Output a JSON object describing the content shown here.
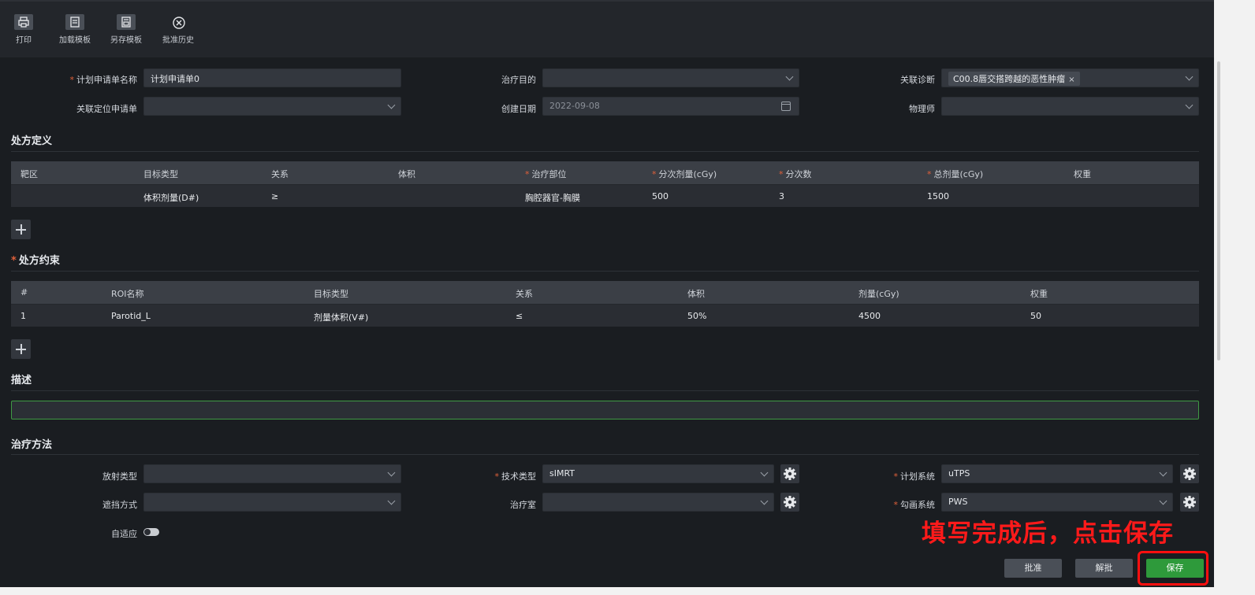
{
  "toolbar": {
    "print": "打印",
    "load_template": "加载模板",
    "save_template": "另存模板",
    "approval_history": "批准历史"
  },
  "form": {
    "plan_name_label": "计划申请单名称",
    "plan_name_value": "计划申请单0",
    "treatment_goal_label": "治疗目的",
    "treatment_goal_value": "",
    "diagnosis_label": "关联诊断",
    "diagnosis_tag": "C00.8唇交搭跨越的恶性肿瘤",
    "positioning_label": "关联定位申请单",
    "positioning_value": "",
    "created_label": "创建日期",
    "created_value": "2022-09-08",
    "physicist_label": "物理师",
    "physicist_value": ""
  },
  "prescription": {
    "title": "处方定义",
    "headers": [
      "靶区",
      "目标类型",
      "关系",
      "体积",
      "治疗部位",
      "分次剂量(cGy)",
      "分次数",
      "总剂量(cGy)",
      "权重"
    ],
    "rows": [
      [
        "",
        "体积剂量(D#)",
        "≥",
        "",
        "胸腔器官-胸膜",
        "500",
        "3",
        "1500",
        ""
      ]
    ]
  },
  "constraints": {
    "title": "处方约束",
    "headers": [
      "#",
      "ROI名称",
      "目标类型",
      "关系",
      "体积",
      "剂量(cGy)",
      "权重"
    ],
    "rows": [
      [
        "1",
        "Parotid_L",
        "剂量体积(V#)",
        "≤",
        "50%",
        "4500",
        "50"
      ]
    ]
  },
  "description": {
    "title": "描述",
    "value": ""
  },
  "method": {
    "title": "治疗方法",
    "radiation_type_label": "放射类型",
    "radiation_type_value": "",
    "technique_label": "技术类型",
    "technique_value": "sIMRT",
    "planning_system_label": "计划系统",
    "planning_system_value": "uTPS",
    "shielding_label": "遮挡方式",
    "shielding_value": "",
    "room_label": "治疗室",
    "room_value": "",
    "contour_system_label": "勾画系统",
    "contour_system_value": "PWS",
    "adaptive_label": "自适应",
    "adaptive_on": false
  },
  "annotation": "填写完成后，点击保存",
  "actions": {
    "approve": "批准",
    "unapprove": "解批",
    "save": "保存"
  },
  "colors": {
    "background": "#1a1d21",
    "field": "#33373e",
    "save_green": "#2e9a3b",
    "annotation_red": "#ff1a1a",
    "required_orange": "#e0603a"
  }
}
